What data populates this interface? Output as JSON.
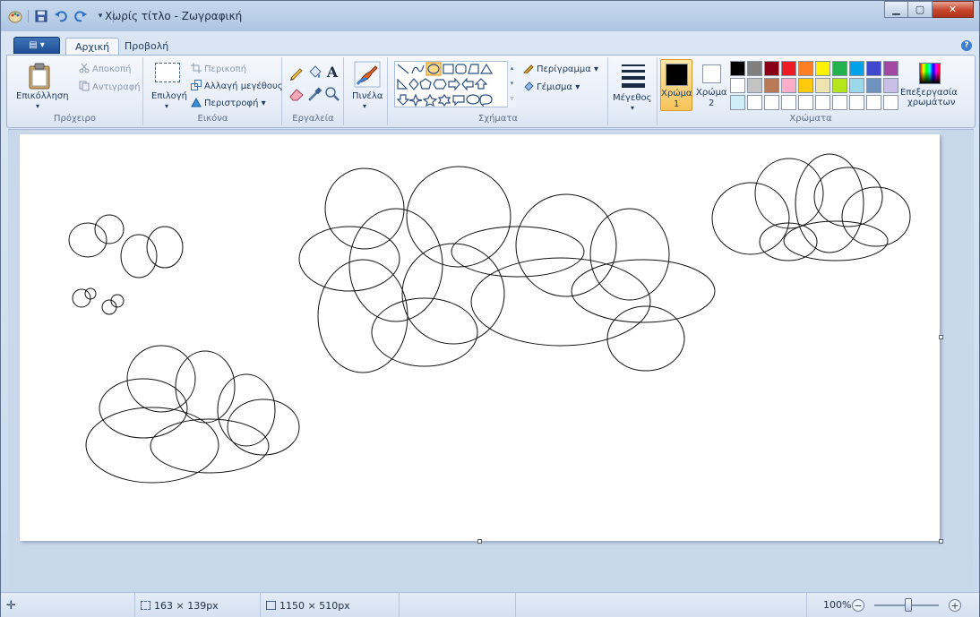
{
  "window": {
    "title": "Χωρίς τίτλο - Ζωγραφική"
  },
  "tabs": {
    "home": "Αρχική",
    "view": "Προβολή"
  },
  "clipboard": {
    "paste": "Επικόλληση",
    "cut": "Αποκοπή",
    "copy": "Αντιγραφή",
    "label": "Πρόχειρο"
  },
  "image": {
    "select": "Επιλογή",
    "crop": "Περικοπή",
    "resize": "Αλλαγή μεγέθους",
    "rotate": "Περιστροφή",
    "label": "Εικόνα"
  },
  "tools": {
    "label": "Εργαλεία"
  },
  "brushes": {
    "label": "Πινέλα"
  },
  "shapes": {
    "outline": "Περίγραμμα",
    "fill": "Γέμισμα",
    "label": "Σχήματα"
  },
  "size": {
    "label": "Μέγεθος"
  },
  "colors": {
    "color1_label": "Χρώμα",
    "color1_num": "1",
    "color2_label": "Χρώμα",
    "color2_num": "2",
    "edit_label_1": "Επεξεργασία",
    "edit_label_2": "χρωμάτων",
    "label": "Χρώματα",
    "color1_value": "#000000",
    "color2_value": "#ffffff",
    "palette_row1": [
      "#000000",
      "#7f7f7f",
      "#880015",
      "#ed1c24",
      "#ff7f27",
      "#fff200",
      "#22b14c",
      "#00a2e8",
      "#3f48cc",
      "#a349a4"
    ],
    "palette_row2": [
      "#ffffff",
      "#c3c3c3",
      "#b97a57",
      "#ffaec9",
      "#ffc90e",
      "#efe4b0",
      "#b5e61d",
      "#99d9ea",
      "#7092be",
      "#c8bfe7"
    ],
    "palette_row3": [
      "#cfeef8",
      "#ffffff",
      "#ffffff",
      "#ffffff",
      "#ffffff",
      "#ffffff",
      "#ffffff",
      "#ffffff",
      "#ffffff",
      "#ffffff"
    ]
  },
  "status": {
    "selection_size": "163 × 139px",
    "canvas_size": "1150 × 510px",
    "zoom": "100%"
  },
  "icons": {
    "app": "paint-app-icon",
    "save": "save-icon",
    "undo": "undo-icon",
    "redo": "redo-icon",
    "cursor_pos": "crosshair-icon",
    "selection": "selection-size-icon",
    "canvas": "canvas-size-icon"
  }
}
